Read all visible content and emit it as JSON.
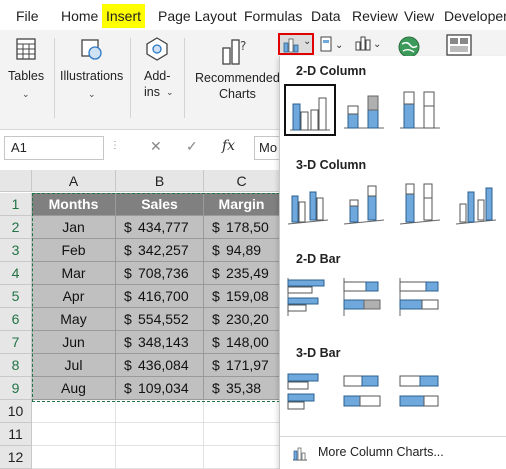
{
  "ribbon_tabs": [
    "File",
    "Home",
    "Insert",
    "Page Layout",
    "Formulas",
    "Data",
    "Review",
    "View",
    "Developer"
  ],
  "ribbon_groups": {
    "tables": "Tables",
    "illustrations": "Illustrations",
    "addins_line1": "Add-",
    "addins_line2": "ins",
    "recommended_line1": "Recommended",
    "recommended_line2": "Charts"
  },
  "formula_bar": {
    "name_box": "A1",
    "cancel": "✕",
    "confirm": "✓",
    "fx": "fx",
    "content": "Mo"
  },
  "sheet": {
    "col_headers": [
      "A",
      "B",
      "C"
    ],
    "row_headers": [
      "1",
      "2",
      "3",
      "4",
      "5",
      "6",
      "7",
      "8",
      "9",
      "10",
      "11",
      "12"
    ],
    "table_headers": [
      "Months",
      "Sales",
      "Margin"
    ],
    "currency": "$",
    "rows": [
      {
        "month": "Jan",
        "sales": "434,777",
        "margin": "178,50"
      },
      {
        "month": "Feb",
        "sales": "342,257",
        "margin": "94,89"
      },
      {
        "month": "Mar",
        "sales": "708,736",
        "margin": "235,49"
      },
      {
        "month": "Apr",
        "sales": "416,700",
        "margin": "159,08"
      },
      {
        "month": "May",
        "sales": "554,552",
        "margin": "230,20"
      },
      {
        "month": "Jun",
        "sales": "348,143",
        "margin": "148,00"
      },
      {
        "month": "Jul",
        "sales": "436,084",
        "margin": "171,97"
      },
      {
        "month": "Aug",
        "sales": "109,034",
        "margin": "35,38"
      }
    ]
  },
  "dropdown": {
    "section_2d_column": "2-D Column",
    "section_3d_column": "3-D Column",
    "section_2d_bar": "2-D Bar",
    "section_3d_bar": "3-D Bar",
    "more_link": "More Column Charts..."
  },
  "colors": {
    "highlight_yellow": "#ffff00",
    "chart_blue": "#6fa8dc",
    "chart_gray": "#b0b0b0",
    "selection_green": "#217346",
    "header_gray": "#808080",
    "data_gray": "#c0c0c0"
  },
  "icons": [
    "table-icon",
    "illustrations-icon",
    "addins-icon",
    "recommended-charts-icon",
    "column-chart-icon",
    "globe-icon",
    "map-icon"
  ]
}
